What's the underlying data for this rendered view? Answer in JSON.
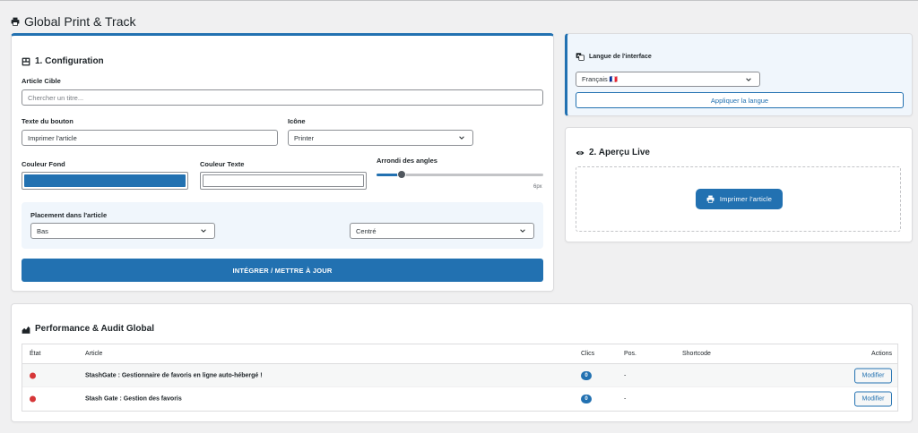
{
  "header": {
    "title": "Global Print & Track",
    "icon": "printer-icon"
  },
  "config": {
    "title": "1. Configuration",
    "article_label": "Article Cible",
    "article_placeholder": "Chercher un titre...",
    "button_text_label": "Texte du bouton",
    "button_text_value": "Imprimer l'article",
    "icon_label": "Icône",
    "icon_value": "Printer",
    "bg_color_label": "Couleur Fond",
    "bg_color": "#2271b1",
    "text_color_label": "Couleur Texte",
    "text_color": "#ffffff",
    "radius_label": "Arrondi des angles",
    "radius_value": "6px",
    "radius_fraction": 0.15,
    "placement_label": "Placement dans l'article",
    "placement_position": "Bas",
    "placement_align": "Centré",
    "submit_label": "INTÉGRER / METTRE À JOUR"
  },
  "language": {
    "title": "Langue de l'interface",
    "selected": "Français 🇫🇷",
    "apply_label": "Appliquer la langue"
  },
  "preview": {
    "title": "2. Aperçu Live",
    "button_label": "Imprimer l'article"
  },
  "performance": {
    "title": "Performance & Audit Global",
    "columns": [
      "État",
      "Article",
      "Clics",
      "Pos.",
      "Shortcode",
      "Actions"
    ],
    "rows": [
      {
        "status": "red",
        "article": "StashGate : Gestionnaire de favoris en ligne auto-hébergé !",
        "clicks": "0",
        "pos": "-",
        "shortcode": "",
        "action": "Modifier"
      },
      {
        "status": "red",
        "article": "Stash Gate : Gestion des favoris",
        "clicks": "0",
        "pos": "-",
        "shortcode": "",
        "action": "Modifier"
      }
    ]
  },
  "colors": {
    "accent": "#2271b1",
    "status_red": "#d63638"
  }
}
